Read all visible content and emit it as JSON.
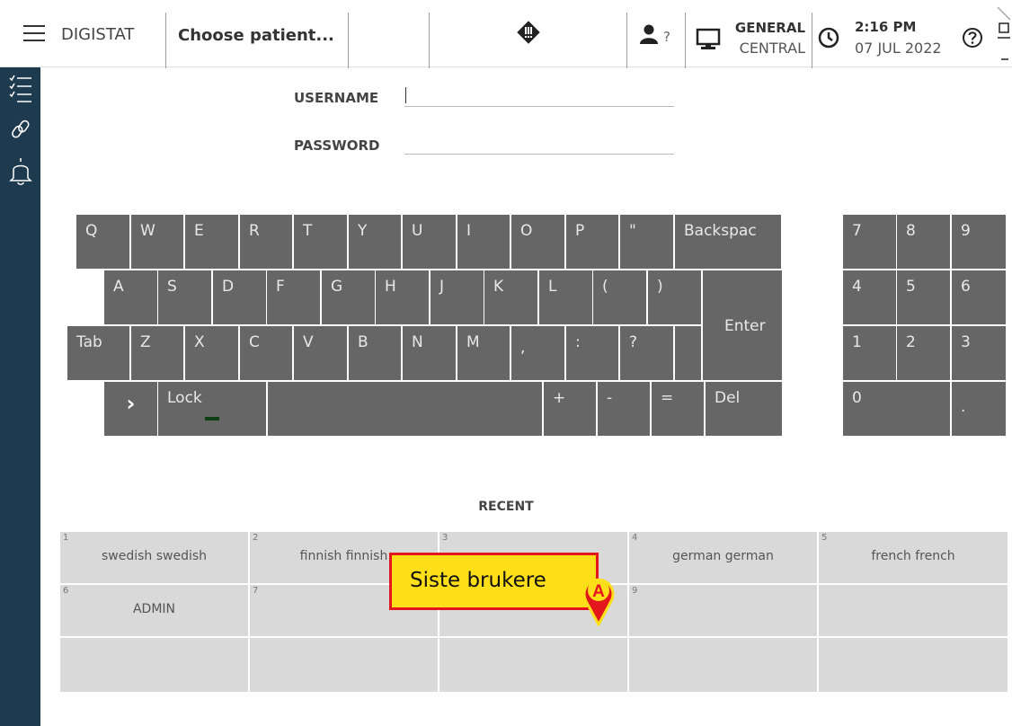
{
  "topbar": {
    "brand": "DIGISTAT",
    "patient": "Choose patient...",
    "user_unknown": "?",
    "workstation_title": "GENERAL",
    "workstation_sub": "CENTRAL",
    "time": "2:16 PM",
    "date": "07 JUL 2022"
  },
  "login": {
    "username_label": "USERNAME",
    "password_label": "PASSWORD",
    "username_value": "",
    "password_value": ""
  },
  "keyboard": {
    "row1": [
      "Q",
      "W",
      "E",
      "R",
      "T",
      "Y",
      "U",
      "I",
      "O",
      "P",
      "\"",
      "Backspac"
    ],
    "row2": [
      "A",
      "S",
      "D",
      "F",
      "G",
      "H",
      "J",
      "K",
      "L",
      "(",
      ")"
    ],
    "enter": "Enter",
    "row3": [
      "Tab",
      "Z",
      "X",
      "C",
      "V",
      "B",
      "N",
      "M",
      ",",
      ":",
      "?"
    ],
    "row4": [
      "Lock",
      "+",
      "-",
      "=",
      "Del"
    ],
    "arrow": "›",
    "numpad": [
      "7",
      "8",
      "9",
      "4",
      "5",
      "6",
      "1",
      "2",
      "3",
      "0",
      "."
    ]
  },
  "recent": {
    "title": "RECENT",
    "cells": [
      {
        "num": "1",
        "name": "swedish swedish"
      },
      {
        "num": "2",
        "name": "finnish finnish"
      },
      {
        "num": "3",
        "name": ""
      },
      {
        "num": "4",
        "name": "german german"
      },
      {
        "num": "5",
        "name": "french french"
      },
      {
        "num": "6",
        "name": "ADMIN"
      },
      {
        "num": "7",
        "name": ""
      },
      {
        "num": "",
        "name": ""
      },
      {
        "num": "9",
        "name": ""
      },
      {
        "num": "",
        "name": ""
      },
      {
        "num": "",
        "name": ""
      },
      {
        "num": "",
        "name": ""
      },
      {
        "num": "",
        "name": ""
      },
      {
        "num": "",
        "name": ""
      },
      {
        "num": "",
        "name": ""
      }
    ]
  },
  "callout": {
    "text": "Siste brukere",
    "marker": "A"
  },
  "colors": {
    "sidebar": "#1e3a4f",
    "key": "#666666",
    "cell": "#d9d9d9",
    "callout_fill": "#ffdf1a",
    "callout_border": "#e3161c"
  }
}
